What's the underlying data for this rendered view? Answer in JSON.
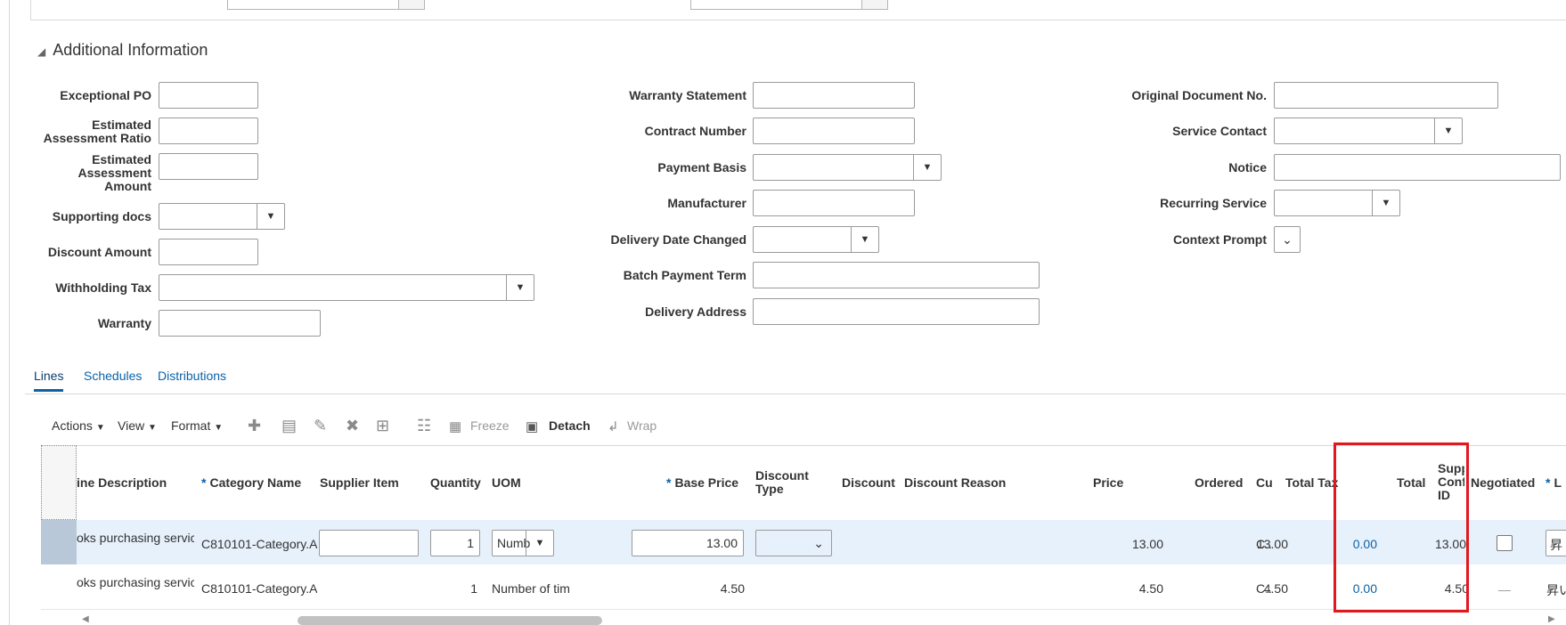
{
  "section": {
    "title": "Additional Information"
  },
  "fields_col1": [
    {
      "label": "Exceptional PO"
    },
    {
      "label": "Estimated Assessment Ratio"
    },
    {
      "label": "Estimated Assessment Amount"
    },
    {
      "label": "Supporting docs"
    },
    {
      "label": "Discount Amount"
    },
    {
      "label": "Withholding Tax"
    },
    {
      "label": "Warranty"
    }
  ],
  "fields_col2": [
    {
      "label": "Warranty Statement"
    },
    {
      "label": "Contract Number"
    },
    {
      "label": "Payment Basis"
    },
    {
      "label": "Manufacturer"
    },
    {
      "label": "Delivery Date Changed"
    },
    {
      "label": "Batch Payment Term"
    },
    {
      "label": "Delivery Address"
    }
  ],
  "fields_col3": [
    {
      "label": "Original Document No."
    },
    {
      "label": "Service Contact"
    },
    {
      "label": "Notice"
    },
    {
      "label": "Recurring Service"
    },
    {
      "label": "Context Prompt"
    }
  ],
  "tabs": [
    {
      "label": "Lines",
      "active": true
    },
    {
      "label": "Schedules"
    },
    {
      "label": "Distributions"
    }
  ],
  "toolbar": {
    "actions": "Actions",
    "view": "View",
    "format": "Format",
    "freeze": "Freeze",
    "detach": "Detach",
    "wrap": "Wrap"
  },
  "columns": {
    "line_description": "ine Description",
    "category_name": "Category Name",
    "supplier_item": "Supplier Item",
    "quantity": "Quantity",
    "uom": "UOM",
    "base_price": "Base Price",
    "discount_type_1": "Discount",
    "discount_type_2": "Type",
    "discount": "Discount",
    "discount_reason": "Discount Reason",
    "price": "Price",
    "ordered": "Ordered",
    "cu": "Cu",
    "total_tax": "Total Tax",
    "total": "Total",
    "supp_conf_1": "Supp",
    "supp_conf_2": "Conf",
    "supp_conf_3": "ID",
    "negotiated": "Negotiated",
    "last": "L"
  },
  "rows": [
    {
      "description": "oks purchasing service",
      "category": "C810101-Category.A",
      "supplier_item": "",
      "quantity": "1",
      "uom": "Numb",
      "base_price": "13.00",
      "price": "13.00",
      "ordered": "13.00",
      "cu": "C..",
      "total_tax": "0.00",
      "total": "13.00",
      "last": "昇"
    },
    {
      "description": "oks purchasing service",
      "category": "C810101-Category.A",
      "quantity": "1",
      "uom": "Number of tim",
      "base_price": "4.50",
      "price": "4.50",
      "ordered": "4.50",
      "cu": "C..",
      "total_tax": "0.00",
      "total": "4.50",
      "negotiated": "—",
      "last": "昇い"
    }
  ],
  "icons": {
    "dropdown": "▼",
    "chevron": "⌄",
    "collapse": "◢"
  }
}
